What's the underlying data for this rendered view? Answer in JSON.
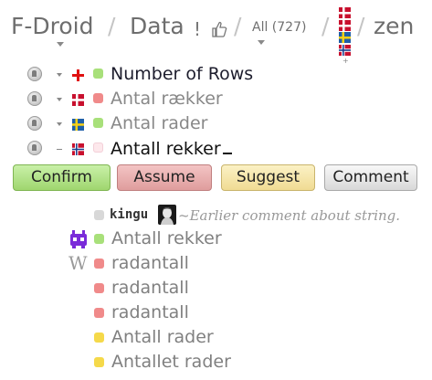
{
  "breadcrumb": {
    "project": "F-Droid",
    "separator": "/",
    "resource": "Data",
    "filter": "All (727)",
    "language_code": "zen"
  },
  "rows": [
    {
      "text": "Number of Rows",
      "flag": "flag-plus-icon",
      "dot_color": "#a8e07a",
      "dark": true
    },
    {
      "text": "Antal rækker",
      "flag": "flag-denmark-icon",
      "dot_color": "#f08a8a",
      "dark": false
    },
    {
      "text": "Antal rader",
      "flag": "flag-sweden-icon",
      "dot_color": "#a8e07a",
      "dark": false
    },
    {
      "text": "Antall rekker",
      "flag": "flag-norway-icon",
      "dot_color": "#fde8ec",
      "dark": true
    }
  ],
  "buttons": {
    "confirm": "Confirm",
    "assume": "Assume",
    "suggest": "Suggest",
    "comment": "Comment"
  },
  "comment": {
    "user": "kingu",
    "text": "Earlier comment about string."
  },
  "suggestions": [
    {
      "text": "Antall rekker",
      "dot_color": "#a8e07a",
      "source": "robot-icon"
    },
    {
      "text": "radantall",
      "dot_color": "#f08a8a",
      "source": "wikipedia-icon"
    },
    {
      "text": "radantall",
      "dot_color": "#f08a8a",
      "source": ""
    },
    {
      "text": "radantall",
      "dot_color": "#f08a8a",
      "source": ""
    },
    {
      "text": "Antall rader",
      "dot_color": "#f5d94a",
      "source": ""
    },
    {
      "text": "Antallet rader",
      "dot_color": "#f5d94a",
      "source": ""
    }
  ],
  "colors": {
    "green": "#a8e07a",
    "red": "#f08a8a",
    "yellow": "#f5d94a",
    "robot_purple": "#7a2bd9"
  }
}
